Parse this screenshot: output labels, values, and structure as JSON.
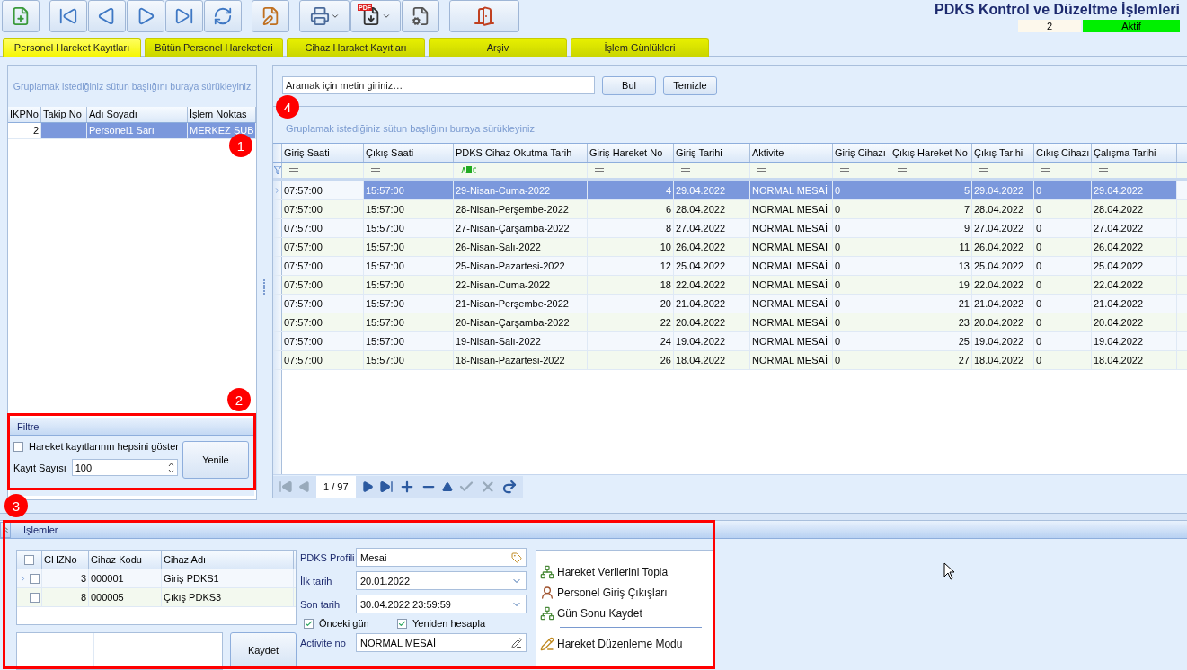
{
  "toolbar": {
    "pdf_label": "PDF"
  },
  "header": {
    "title": "PDKS Kontrol ve Düzeltme İşlemleri",
    "count": "2",
    "status": "Aktif"
  },
  "tabs": [
    {
      "label": "Personel Hareket Kayıtları",
      "selected": true
    },
    {
      "label": "Bütün Personel Hareketleri",
      "selected": false
    },
    {
      "label": "Cihaz Haraket Kayıtları",
      "selected": false
    },
    {
      "label": "Arşiv",
      "selected": false
    },
    {
      "label": "İşlem Günlükleri",
      "selected": false
    }
  ],
  "personnel": {
    "group_hint": "Gruplamak istediğiniz sütun başlığını buraya sürükleyiniz",
    "columns": [
      {
        "label": "IKPNo",
        "kind": "number"
      },
      {
        "label": "Takip No",
        "kind": "text"
      },
      {
        "label": "Adı Soyadı",
        "kind": "text"
      },
      {
        "label": "İşlem Noktas",
        "kind": "text"
      }
    ],
    "rows": [
      {
        "cells": [
          "2",
          null,
          "Personel1 Sarı",
          "MERKEZ ŞUB"
        ],
        "selected": true
      }
    ]
  },
  "filter": {
    "title": "Filtre",
    "show_all": {
      "label": "Hareket kayıtlarının hepsini göster",
      "checked": false
    },
    "count_label": "Kayıt Sayısı",
    "count_value": "100",
    "refresh_button": "Yenile"
  },
  "movements": {
    "search_placeholder": "Aramak için metin giriniz…",
    "find_button": "Bul",
    "clear_button": "Temizle",
    "group_hint": "Gruplamak istediğiniz sütun başlığını buraya sürükleyiniz",
    "columns": [
      {
        "label": "Giriş Saati",
        "kind": "text"
      },
      {
        "label": "Çıkış Saati",
        "kind": "text"
      },
      {
        "label": "PDKS Cihaz Okutma Tarih",
        "kind": "text"
      },
      {
        "label": "Giriş Hareket No",
        "kind": "number"
      },
      {
        "label": "Giriş Tarihi",
        "kind": "text"
      },
      {
        "label": "Aktivite",
        "kind": "text"
      },
      {
        "label": "Giriş Cihazı",
        "kind": "text"
      },
      {
        "label": "Çıkış Hareket No",
        "kind": "number"
      },
      {
        "label": "Çıkış Tarihi",
        "kind": "text"
      },
      {
        "label": "Cıkış Cihazı",
        "kind": "text"
      },
      {
        "label": "Çalışma Tarihi",
        "kind": "text"
      }
    ],
    "filter_row": [
      {
        "kind": "equals"
      },
      {
        "kind": "equals"
      },
      {
        "kind": "abc"
      },
      {
        "kind": "equals"
      },
      {
        "kind": "equals"
      },
      {
        "kind": "equals"
      },
      {
        "kind": "equals"
      },
      {
        "kind": "equals"
      },
      {
        "kind": "equals"
      },
      {
        "kind": "equals"
      },
      {
        "kind": "equals"
      }
    ],
    "rows": [
      {
        "selected": true,
        "cells": [
          "07:57:00",
          "15:57:00",
          "29-Nisan-Cuma-2022",
          "4",
          "29.04.2022",
          "NORMAL MESAİ",
          "0",
          "5",
          "29.04.2022",
          "0",
          "29.04.2022"
        ]
      },
      {
        "selected": false,
        "cells": [
          "07:57:00",
          "15:57:00",
          "28-Nisan-Perşembe-2022",
          "6",
          "28.04.2022",
          "NORMAL MESAİ",
          "0",
          "7",
          "28.04.2022",
          "0",
          "28.04.2022"
        ]
      },
      {
        "selected": false,
        "cells": [
          "07:57:00",
          "15:57:00",
          "27-Nisan-Çarşamba-2022",
          "8",
          "27.04.2022",
          "NORMAL MESAİ",
          "0",
          "9",
          "27.04.2022",
          "0",
          "27.04.2022"
        ]
      },
      {
        "selected": false,
        "cells": [
          "07:57:00",
          "15:57:00",
          "26-Nisan-Salı-2022",
          "10",
          "26.04.2022",
          "NORMAL MESAİ",
          "0",
          "11",
          "26.04.2022",
          "0",
          "26.04.2022"
        ]
      },
      {
        "selected": false,
        "cells": [
          "07:57:00",
          "15:57:00",
          "25-Nisan-Pazartesi-2022",
          "12",
          "25.04.2022",
          "NORMAL MESAİ",
          "0",
          "13",
          "25.04.2022",
          "0",
          "25.04.2022"
        ]
      },
      {
        "selected": false,
        "cells": [
          "07:57:00",
          "15:57:00",
          "22-Nisan-Cuma-2022",
          "18",
          "22.04.2022",
          "NORMAL MESAİ",
          "0",
          "19",
          "22.04.2022",
          "0",
          "22.04.2022"
        ]
      },
      {
        "selected": false,
        "cells": [
          "07:57:00",
          "15:57:00",
          "21-Nisan-Perşembe-2022",
          "20",
          "21.04.2022",
          "NORMAL MESAİ",
          "0",
          "21",
          "21.04.2022",
          "0",
          "21.04.2022"
        ]
      },
      {
        "selected": false,
        "cells": [
          "07:57:00",
          "15:57:00",
          "20-Nisan-Çarşamba-2022",
          "22",
          "20.04.2022",
          "NORMAL MESAİ",
          "0",
          "23",
          "20.04.2022",
          "0",
          "20.04.2022"
        ]
      },
      {
        "selected": false,
        "cells": [
          "07:57:00",
          "15:57:00",
          "19-Nisan-Salı-2022",
          "24",
          "19.04.2022",
          "NORMAL MESAİ",
          "0",
          "25",
          "19.04.2022",
          "0",
          "19.04.2022"
        ]
      },
      {
        "selected": false,
        "cells": [
          "07:57:00",
          "15:57:00",
          "18-Nisan-Pazartesi-2022",
          "26",
          "18.04.2022",
          "NORMAL MESAİ",
          "0",
          "27",
          "18.04.2022",
          "0",
          "18.04.2022"
        ]
      }
    ],
    "page": "1 / 97"
  },
  "operations": {
    "title": "İşlemler",
    "devices": {
      "all_checked": false,
      "columns": [
        {
          "label": "CHZNo",
          "kind": "number"
        },
        {
          "label": "Cihaz Kodu",
          "kind": "text"
        },
        {
          "label": "Cihaz Adı",
          "kind": "text"
        }
      ],
      "rows": [
        {
          "cells": [
            "3",
            "000001",
            "Giriş PDKS1"
          ],
          "checked": false,
          "selected": true
        },
        {
          "cells": [
            "8",
            "000005",
            "Çıkış PDKS3"
          ],
          "checked": false,
          "selected": false
        }
      ]
    },
    "save_button": "Kaydet",
    "fields": [
      {
        "label": "PDKS Profili",
        "value": "Mesai",
        "kind": "tag"
      },
      {
        "label": "İlk tarih",
        "value": "20.01.2022",
        "kind": "dropdown"
      },
      {
        "label": "Son tarih",
        "value": "30.04.2022 23:59:59",
        "kind": "dropdown"
      }
    ],
    "options": [
      {
        "label": "Önceki gün",
        "checked": true
      },
      {
        "label": "Yeniden hesapla",
        "checked": true
      }
    ],
    "activity": {
      "label": "Activite no",
      "value": "NORMAL MESAİ",
      "kind": "edit"
    },
    "actions": [
      {
        "label": "Hareket Verilerini Topla",
        "kind": "collect",
        "separator_before": false
      },
      {
        "label": "Personel Giriş Çıkışları",
        "kind": "person",
        "separator_before": false
      },
      {
        "label": "Gün Sonu Kaydet",
        "kind": "collect",
        "separator_before": false
      },
      {
        "label": "Hareket Düzenleme Modu",
        "kind": "edit",
        "separator_before": true
      }
    ]
  },
  "callouts": [
    "1",
    "2",
    "3",
    "4"
  ]
}
